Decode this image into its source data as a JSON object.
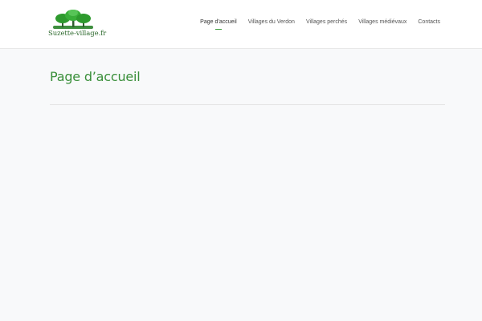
{
  "header": {
    "logo": {
      "text": "Suzette-village.fr",
      "icon": "tree-icon"
    },
    "nav": {
      "items": [
        {
          "label": "Page d’accueil",
          "active": true
        },
        {
          "label": "Villages du Verdon",
          "active": false
        },
        {
          "label": "Villages perchés",
          "active": false
        },
        {
          "label": "Villages médiévaux",
          "active": false
        },
        {
          "label": "Contacts",
          "active": false
        }
      ]
    }
  },
  "main": {
    "title": "Page d’accueil"
  },
  "colors": {
    "accent": "#3a9b3a",
    "title": "#3a8f3a",
    "background": "#f8f9fa"
  }
}
